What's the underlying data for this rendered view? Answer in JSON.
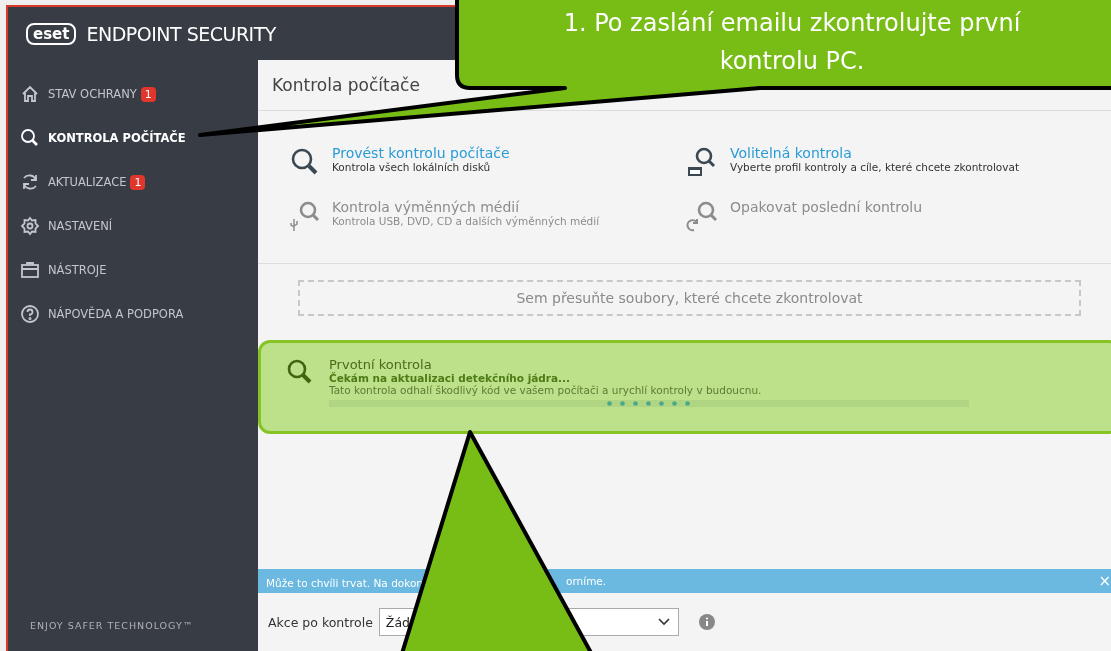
{
  "app": {
    "logo": "eset",
    "title": "ENDPOINT SECURITY",
    "footer": "ENJOY SAFER TECHNOLOGY™"
  },
  "sidebar": {
    "items": [
      {
        "label": "STAV OCHRANY",
        "badge": "1",
        "selected": false
      },
      {
        "label": "KONTROLA POČÍTAČE",
        "selected": true
      },
      {
        "label": "AKTUALIZACE",
        "badge": "1",
        "selected": false
      },
      {
        "label": "NASTAVENÍ",
        "selected": false
      },
      {
        "label": "NÁSTROJE",
        "selected": false
      },
      {
        "label": "NÁPOVĚDA A PODPORA",
        "selected": false
      }
    ]
  },
  "page": {
    "title": "Kontrola počítače",
    "scan_options": [
      {
        "title": "Provést kontrolu počítače",
        "description": "Kontrola všech lokálních disků",
        "disabled": false
      },
      {
        "title": "Volitelná kontrola",
        "description": "Vyberte profil kontroly a cíle, které chcete zkontrolovat",
        "disabled": false
      },
      {
        "title": "Kontrola výměnných médií",
        "description": "Kontrola USB, DVD, CD a dalších výměnných médií",
        "disabled": true
      },
      {
        "title": "Opakovat poslední kontrolu",
        "disabled": true
      }
    ],
    "drop_zone": "Sem přesuňte soubory, které chcete zkontrolovat",
    "scan_card": {
      "title": "Prvotní kontrola",
      "status": "Čekám na aktualizaci detekčního jádra...",
      "description": "Tato kontrola odhalí škodlivý kód ve vašem počítači a urychlí kontroly v budoucnu."
    },
    "notice": {
      "text_parts": [
        "Může to chvíli trvat. Na dokon",
        "orníme."
      ],
      "close": "×"
    },
    "after_scan": {
      "label": "Akce po kontrole",
      "value": "Žád"
    }
  },
  "callouts": [
    {
      "kind": "bubble",
      "lines": [
        "1. Po zaslání emailu zkontrolujte první",
        "kontrolu PC."
      ]
    },
    {
      "kind": "arrow"
    }
  ]
}
